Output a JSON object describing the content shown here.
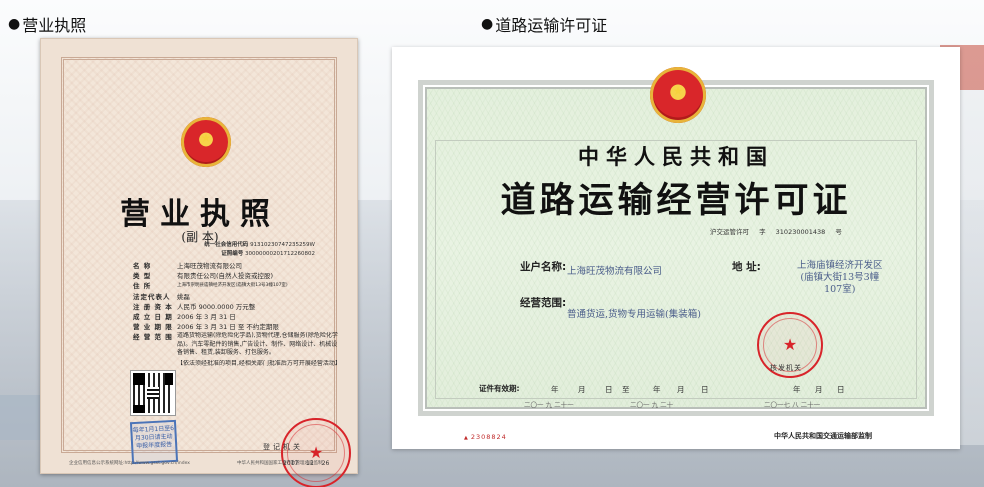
{
  "headings": {
    "left": "营业执照",
    "right": "道路运输许可证"
  },
  "license": {
    "title": "营业执照",
    "subtitle": "(副  本)",
    "credit_code_label": "统一社会信用代码",
    "credit_code": "91310230747235259W",
    "cert_no_label": "证照编号",
    "cert_no": "30000000201712260802",
    "fields": [
      {
        "key": "名        称",
        "value": "上海旺茂物流有限公司"
      },
      {
        "key": "类        型",
        "value": "有限责任公司(自然人投资或控股)"
      },
      {
        "key": "住        所",
        "value": "上海市崇明县庙镇经济开发区(庙镇大街13号3幢107室)"
      },
      {
        "key": "法定代表人",
        "value": "姚磊"
      },
      {
        "key": "注 册 资 本",
        "value": "人民币 9000.0000 万元整"
      },
      {
        "key": "成 立 日 期",
        "value": "2006 年 3 月 31 日"
      },
      {
        "key": "营 业 期 限",
        "value": "2006 年 3 月 31 日  至  不约定期限"
      },
      {
        "key": "经 营 范 围",
        "value": "道路货物运输(除危险化学品),货物代理,仓储服务(除危险化学品)。汽车零配件的销售,广告设计、制作、网络设计、机械设备销售、租赁,装卸服务、打包服务。"
      }
    ],
    "note": "【依法须经批准的项目,经相关部门批准后方可开展经营活动】",
    "annual_stamp": "每年1月1日至6月30日请主动申报年度报告",
    "authority": "登记机关",
    "date": "2017  12  26",
    "footer_left": "企业信用信息公示系统网址:http://www.gsxt.gov.cn/index",
    "footer_right": "中华人民共和国国家工商行政管理总局监制"
  },
  "permit": {
    "title1": "中华人民共和国",
    "title2": "道路运输经营许可证",
    "code_prefix": "沪交运管许可",
    "code_word": "字",
    "code_number": "310230001438",
    "code_suffix": "号",
    "owner_label": "业户名称:",
    "owner_value": "上海旺茂物流有限公司",
    "address_label": "地      址:",
    "address_value_line1": "上海庙镇经济开发区",
    "address_value_line2": "(庙镇大街13号3幢",
    "address_value_line3": "107室)",
    "scope_label": "经营范围:",
    "scope_value": "普通货运,货物专用运输(集装箱)",
    "issuer": "核发机关",
    "valid_label": "证件有效期:",
    "year": "年",
    "month": "月",
    "day": "日",
    "to": "至",
    "valid_from_vals": "二〇一    九    二十一",
    "valid_to_vals": "二〇一    九    二十",
    "issue_date_vals": "二〇一七    八    二十一",
    "serial": "2308824",
    "ministry": "中华人民共和国交通运输部监制"
  }
}
